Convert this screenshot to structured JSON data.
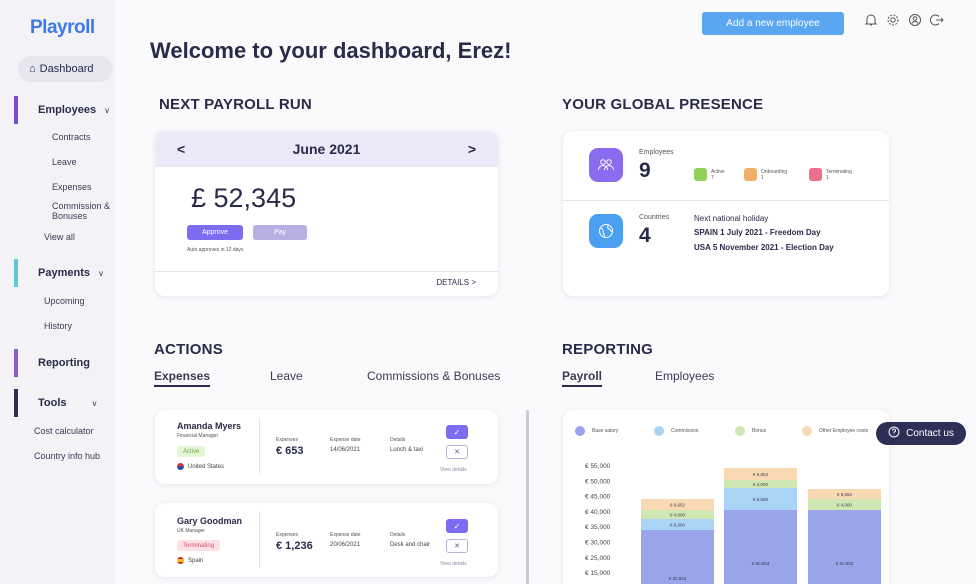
{
  "app": {
    "logo": "Playroll"
  },
  "sidebar": {
    "dashboard": "Dashboard",
    "employees": {
      "label": "Employees",
      "chevron": "v",
      "items": [
        "Contracts",
        "Leave",
        "Expenses",
        "Commission & Bonuses",
        "View all"
      ]
    },
    "payments": {
      "label": "Payments",
      "chevron": "v",
      "items": [
        "Upcoming",
        "History"
      ]
    },
    "reporting": {
      "label": "Reporting"
    },
    "tools": {
      "label": "Tools",
      "chevron": "v",
      "items": [
        "Cost calculator",
        "Country info hub"
      ]
    }
  },
  "header": {
    "welcome": "Welcome to your dashboard, Erez!",
    "add_employee": "Add a new employee",
    "icons": [
      "bell-icon",
      "settings-icon",
      "profile-icon",
      "logout-icon"
    ]
  },
  "payroll": {
    "title": "NEXT PAYROLL RUN",
    "month": "June 2021",
    "prev": "<",
    "next": ">",
    "amount": "£ 52,345",
    "approve": "Approve",
    "pay": "Pay",
    "auto_note": "Auto approves in 12 days",
    "details": "DETAILS >"
  },
  "global": {
    "title": "YOUR GLOBAL PRESENCE",
    "employees_label": "Employees",
    "employees_count": "9",
    "statuses": [
      {
        "label": "Active",
        "count": "7",
        "color": "#8fcf5a"
      },
      {
        "label": "Onboarding",
        "count": "1",
        "color": "#f0b06a"
      },
      {
        "label": "Terminating",
        "count": "1",
        "color": "#ef6f8a"
      }
    ],
    "countries_label": "Countries",
    "countries_count": "4",
    "holiday_title": "Next national holiday",
    "holiday_1": "SPAIN  1 July 2021 - Freedom Day",
    "holiday_2": "USA  5 November 2021 - Election Day"
  },
  "actions": {
    "title": "ACTIONS",
    "tabs": [
      "Expenses",
      "Leave",
      "Commissions & Bonuses"
    ],
    "expenses": [
      {
        "name": "Amanda Myers",
        "role": "Financial Manager",
        "status": "Active",
        "country": "United States",
        "exp_label": "Expenses",
        "amount": "€ 653",
        "date_label": "Expense date",
        "date": "14/06/2021",
        "det_label": "Details",
        "details": "Lunch & taxi",
        "view": "View details"
      },
      {
        "name": "Gary Goodman",
        "role": "UK Manager",
        "status": "Terminating",
        "country": "Spain",
        "exp_label": "Expenses",
        "amount": "€ 1,236",
        "date_label": "Expense date",
        "date": "20/06/2021",
        "det_label": "Details",
        "details": "Desk and chair",
        "view": "View details"
      }
    ]
  },
  "reporting": {
    "title": "REPORTING",
    "tabs": [
      "Payroll",
      "Employees"
    ],
    "contact": "Contact us"
  },
  "chart_data": {
    "type": "bar",
    "stacked": true,
    "series": [
      {
        "name": "Base salary",
        "color": "#9aa4ea",
        "labels": [
          "€ 30,653",
          "€ 60,653",
          "€ 60,653"
        ]
      },
      {
        "name": "Commission",
        "color": "#a9d4f6",
        "labels": [
          "€ 6,600",
          "€ 6,600",
          ""
        ]
      },
      {
        "name": "Bonus",
        "color": "#cfe7b2",
        "labels": [
          "€ 4,000",
          "€ 4,000",
          "€ 4,000"
        ]
      },
      {
        "name": "Other Employee costs",
        "color": "#f8d9b3",
        "labels": [
          "€ 6,652",
          "€ 6,653",
          "€ 6,652"
        ]
      }
    ],
    "ytick_labels": [
      "€ 55,000",
      "€ 50,000",
      "€ 45,000",
      "€ 40,000",
      "€ 35,000",
      "€ 30,000",
      "€ 25,000",
      "€ 15,000"
    ]
  }
}
